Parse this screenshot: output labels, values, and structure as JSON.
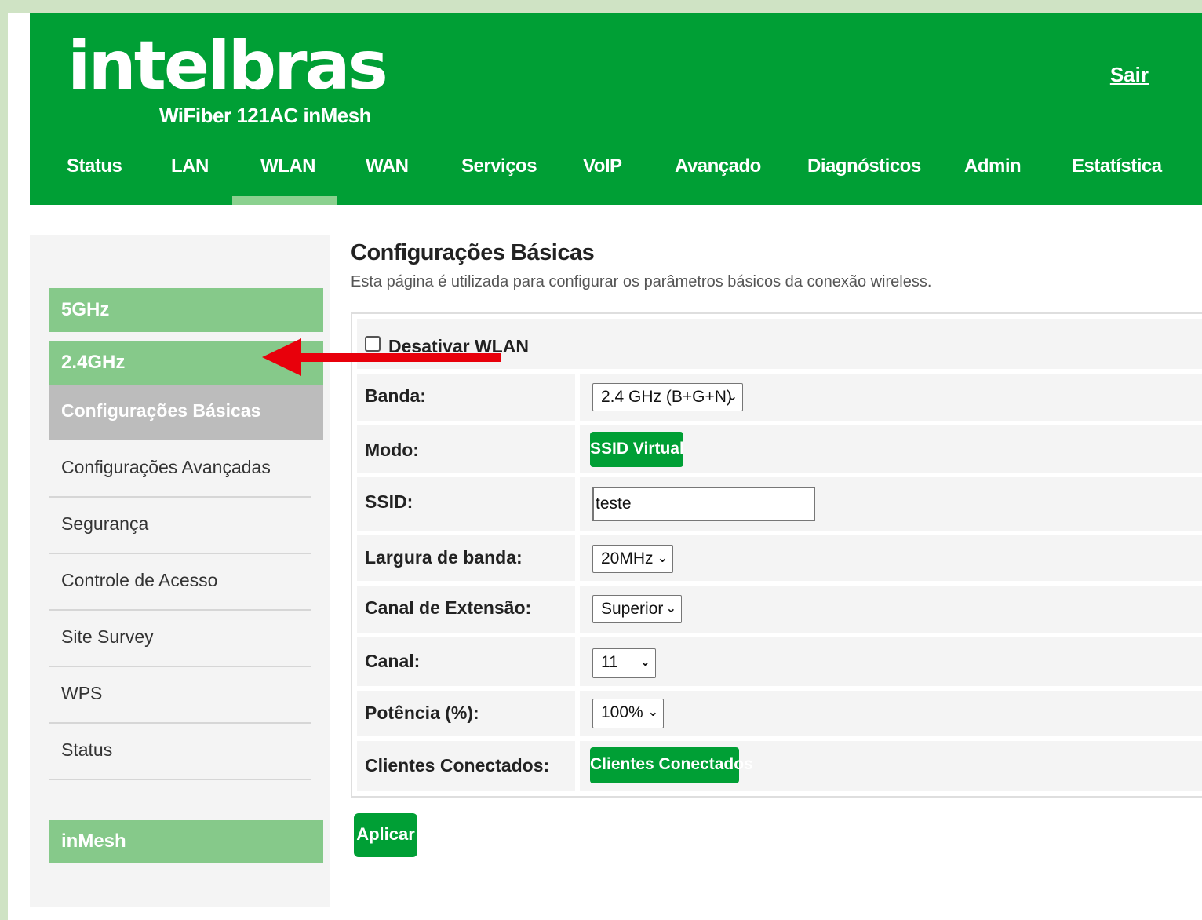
{
  "header": {
    "brand": "intelbras",
    "model": "WiFiber 121AC inMesh",
    "logout_label": "Sair",
    "bg_color": "#009f35"
  },
  "nav": {
    "items": [
      "Status",
      "LAN",
      "WLAN",
      "WAN",
      "Serviços",
      "VoIP",
      "Avançado",
      "Diagnósticos",
      "Admin",
      "Estatística"
    ],
    "active": "WLAN"
  },
  "sidebar": {
    "group_5ghz": "5GHz",
    "group_24ghz": "2.4GHz",
    "active_item": "Configurações Básicas",
    "items": [
      "Configurações Avançadas",
      "Segurança",
      "Controle de Acesso",
      "Site Survey",
      "WPS",
      "Status"
    ],
    "group_inmesh": "inMesh"
  },
  "main": {
    "title": "Configurações Básicas",
    "description": "Esta página é utilizada para configurar os parâmetros básicos da conexão wireless.",
    "disable_wlan_label": "Desativar WLAN",
    "disable_wlan_checked": false,
    "rows": {
      "banda": {
        "label": "Banda:",
        "value": "2.4 GHz (B+G+N)"
      },
      "modo": {
        "label": "Modo:",
        "button": "SSID Virtual"
      },
      "ssid": {
        "label": "SSID:",
        "value": "teste"
      },
      "largura": {
        "label": "Largura de banda:",
        "value": "20MHz"
      },
      "extensao": {
        "label": "Canal de Extensão:",
        "value": "Superior"
      },
      "canal": {
        "label": "Canal:",
        "value": "11"
      },
      "potencia": {
        "label": "Potência (%):",
        "value": "100%"
      },
      "clientes": {
        "label": "Clientes Conectados:",
        "button": "Clientes Conectados"
      }
    },
    "apply_label": "Aplicar"
  },
  "icons": {
    "chevron": "chevron-down-icon",
    "arrow": "red-arrow-annotation"
  },
  "colors": {
    "accent": "#009f35",
    "sidebar_group": "#86c98a",
    "annotation": "#e8000b"
  }
}
